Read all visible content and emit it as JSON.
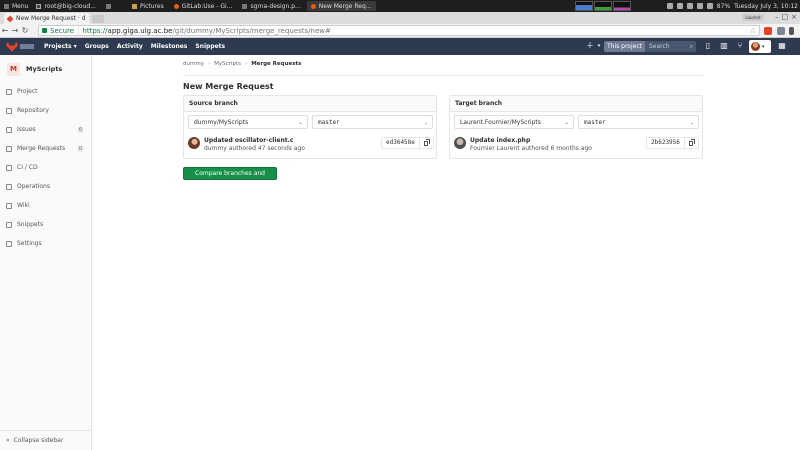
{
  "os_taskbar": {
    "menu_label": "Menu",
    "tasks": [
      {
        "label": "root@big-cloud...",
        "icon": "terminal-icon",
        "active": false
      },
      {
        "label": "",
        "icon": "window-icon",
        "active": false
      },
      {
        "label": "Pictures",
        "icon": "folder-icon",
        "active": false
      },
      {
        "label": "GitLab:Use - Gi...",
        "icon": "firefox-icon",
        "active": false
      },
      {
        "label": "sgrna-design.p...",
        "icon": "document-icon",
        "active": false
      },
      {
        "label": "New Merge Req...",
        "icon": "firefox-icon",
        "active": true
      }
    ],
    "battery": "87%",
    "datetime": "Tuesday July  3, 10:12"
  },
  "browser": {
    "tab_title": "New Merge Request · d",
    "user_label": "Laurent",
    "secure_label": "Secure",
    "url_scheme": "https://",
    "url_host": "app.giga.ulg.ac.be",
    "url_path": "/git/dummy/MyScripts/merge_requests/new#"
  },
  "gitlab_header": {
    "nav": [
      "Projects ▾",
      "Groups",
      "Activity",
      "Milestones",
      "Snippets"
    ],
    "search_scope": "This project",
    "search_placeholder": "Search"
  },
  "sidebar": {
    "project_initial": "M",
    "project_name": "MyScripts",
    "items": [
      {
        "label": "Project",
        "icon": "home-icon",
        "count": null
      },
      {
        "label": "Repository",
        "icon": "repository-icon",
        "count": null
      },
      {
        "label": "Issues",
        "icon": "issues-icon",
        "count": "0"
      },
      {
        "label": "Merge Requests",
        "icon": "merge-request-icon",
        "count": "0"
      },
      {
        "label": "CI / CD",
        "icon": "rocket-icon",
        "count": null
      },
      {
        "label": "Operations",
        "icon": "cloud-gear-icon",
        "count": null
      },
      {
        "label": "Wiki",
        "icon": "book-icon",
        "count": null
      },
      {
        "label": "Snippets",
        "icon": "scissors-icon",
        "count": null
      },
      {
        "label": "Settings",
        "icon": "gear-icon",
        "count": null
      }
    ],
    "collapse_label": "Collapse sidebar"
  },
  "breadcrumb": [
    "dummy",
    "MyScripts",
    "Merge Requests"
  ],
  "page_title": "New Merge Request",
  "source": {
    "heading": "Source branch",
    "project": "dummy/MyScripts",
    "branch": "master",
    "commit_title": "Updated oscillator-client.c",
    "commit_meta": "dummy authored 47 seconds ago",
    "sha": "ed36458e"
  },
  "target": {
    "heading": "Target branch",
    "project": "Laurent.Fournier/MyScripts",
    "branch": "master",
    "commit_title": "Update index.php",
    "commit_meta": "Fournier Laurent authored 6 months ago",
    "sha": "2b623956"
  },
  "compare_button": "Compare branches and continue",
  "colors": {
    "header_bg": "#2e3a50",
    "primary_button": "#168f48",
    "secure_green": "#0b8043"
  }
}
